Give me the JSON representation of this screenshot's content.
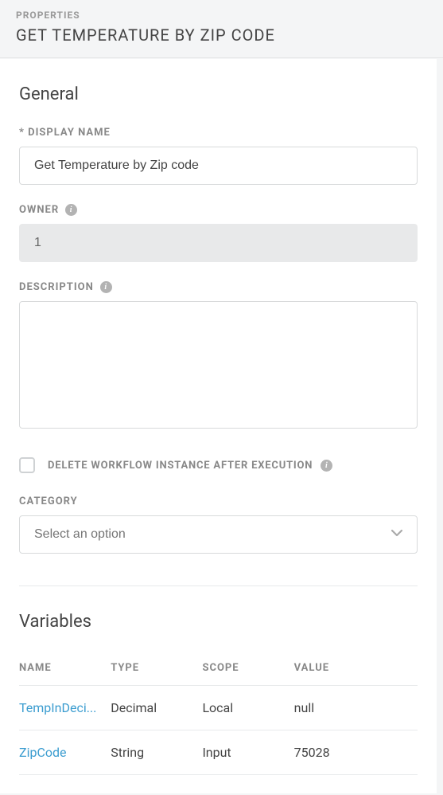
{
  "header": {
    "label": "PROPERTIES",
    "title": "GET TEMPERATURE BY ZIP CODE"
  },
  "general": {
    "section_title": "General",
    "display_name": {
      "label": "* DISPLAY NAME",
      "value": "Get Temperature by Zip code"
    },
    "owner": {
      "label": "OWNER",
      "value": "1"
    },
    "description": {
      "label": "DESCRIPTION",
      "value": ""
    },
    "delete_after": {
      "label": "DELETE WORKFLOW INSTANCE AFTER EXECUTION",
      "checked": false
    },
    "category": {
      "label": "CATEGORY",
      "placeholder": "Select an option"
    }
  },
  "variables": {
    "section_title": "Variables",
    "columns": {
      "name": "NAME",
      "type": "TYPE",
      "scope": "SCOPE",
      "value": "VALUE"
    },
    "rows": [
      {
        "name": "TempInDeci...",
        "type": "Decimal",
        "scope": "Local",
        "value": "null"
      },
      {
        "name": "ZipCode",
        "type": "String",
        "scope": "Input",
        "value": "75028"
      }
    ]
  }
}
